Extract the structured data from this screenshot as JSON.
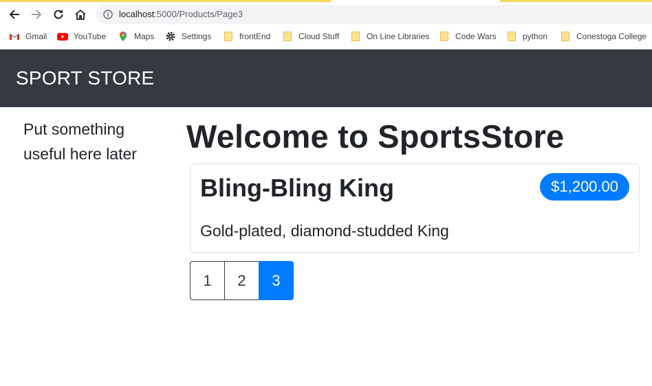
{
  "browser": {
    "url_host": "localhost",
    "url_path": ":5000/Products/Page3",
    "bookmarks": [
      {
        "label": "Gmail",
        "icon": "gmail-icon"
      },
      {
        "label": "YouTube",
        "icon": "youtube-icon"
      },
      {
        "label": "Maps",
        "icon": "maps-icon"
      },
      {
        "label": "Settings",
        "icon": "gear-icon"
      },
      {
        "label": "frontEnd",
        "icon": "folder-icon"
      },
      {
        "label": "Cloud Stuff",
        "icon": "folder-icon"
      },
      {
        "label": "On Line Libraries",
        "icon": "folder-icon"
      },
      {
        "label": "Code Wars",
        "icon": "folder-icon"
      },
      {
        "label": "python",
        "icon": "folder-icon"
      },
      {
        "label": "Conestoga College",
        "icon": "folder-icon"
      }
    ]
  },
  "navbar": {
    "brand": "SPORT STORE",
    "background": "#343a40"
  },
  "sidebar": {
    "text": "Put something useful here later"
  },
  "main": {
    "heading": "Welcome to SportsStore",
    "product": {
      "name": "Bling-Bling King",
      "price": "$1,200.00",
      "description": "Gold-plated, diamond-studded King"
    },
    "pagination": {
      "pages": [
        "1",
        "2",
        "3"
      ],
      "current": "3",
      "accent": "#007bff"
    }
  }
}
